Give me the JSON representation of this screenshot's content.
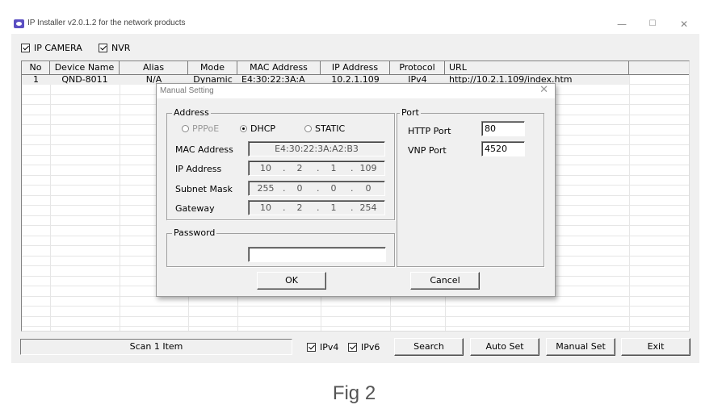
{
  "window": {
    "title": "IP Installer v2.0.1.2 for the network products",
    "minimize_glyph": "—",
    "maximize_glyph": "☐",
    "close_glyph": "✕"
  },
  "filters": {
    "ip_camera_label": "IP CAMERA",
    "nvr_label": "NVR"
  },
  "table": {
    "columns": [
      "No",
      "Device Name",
      "Alias",
      "Mode",
      "MAC Address",
      "IP Address",
      "Protocol",
      "URL"
    ],
    "rows": [
      {
        "no": "1",
        "device_name": "QND-8011",
        "alias": "N/A",
        "mode": "Dynamic",
        "mac": "E4:30:22:3A:A",
        "ip": "10.2.1.109",
        "protocol": "IPv4",
        "url": "http://10.2.1.109/index.htm"
      }
    ]
  },
  "bottom_bar": {
    "status_text": "Scan 1 Item",
    "ipv4_label": "IPv4",
    "ipv6_label": "IPv6",
    "search_label": "Search",
    "auto_set_label": "Auto Set",
    "manual_set_label": "Manual Set",
    "exit_label": "Exit"
  },
  "dialog": {
    "title": "Manual Setting",
    "close_glyph": "✕",
    "address_group": "Address",
    "radio_pppoe": "PPPoE",
    "radio_dhcp": "DHCP",
    "radio_static": "STATIC",
    "mac_label": "MAC Address",
    "mac_value": "E4:30:22:3A:A2:B3",
    "ip_label": "IP Address",
    "ip_octets": [
      "10",
      "2",
      "1",
      "109"
    ],
    "subnet_label": "Subnet Mask",
    "subnet_octets": [
      "255",
      "0",
      "0",
      "0"
    ],
    "gateway_label": "Gateway",
    "gateway_octets": [
      "10",
      "2",
      "1",
      "254"
    ],
    "ip_dot": ".",
    "password_group": "Password",
    "password_value": "",
    "port_group": "Port",
    "http_port_label": "HTTP Port",
    "http_port_value": "80",
    "vnp_port_label": "VNP Port",
    "vnp_port_value": "4520",
    "ok_label": "OK",
    "cancel_label": "Cancel"
  },
  "caption": "Fig 2"
}
